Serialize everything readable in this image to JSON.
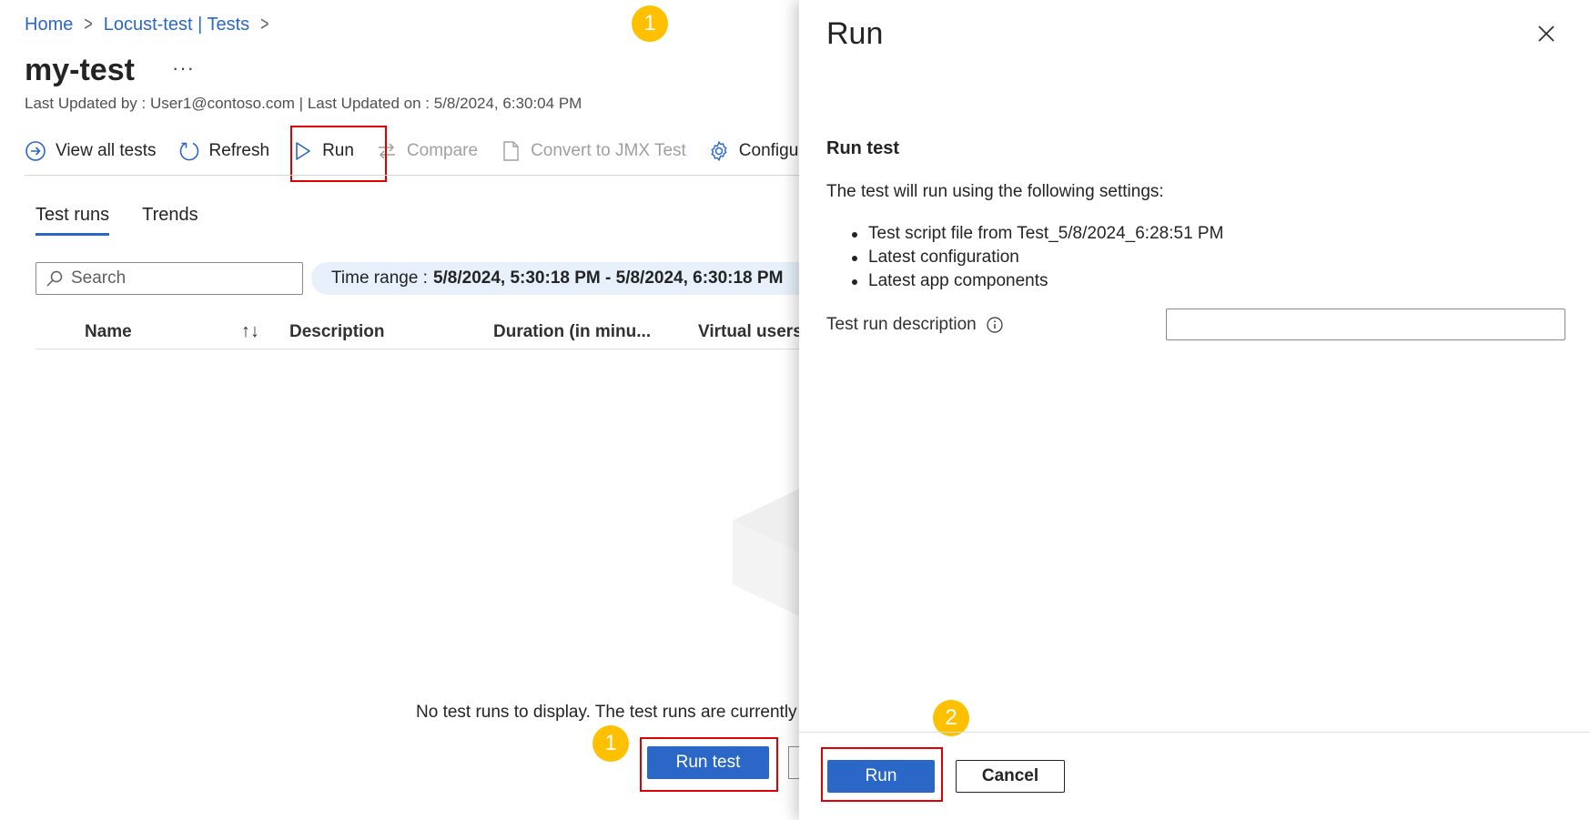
{
  "breadcrumb": {
    "home": "Home",
    "parent": "Locust-test | Tests",
    "sep": ">"
  },
  "page": {
    "title": "my-test",
    "more": "···",
    "subtitle": "Last Updated by : User1@contoso.com | Last Updated on : 5/8/2024, 6:30:04 PM"
  },
  "toolbar": {
    "view_all": "View all tests",
    "refresh": "Refresh",
    "run": "Run",
    "compare": "Compare",
    "convert": "Convert to JMX Test",
    "configure": "Configure"
  },
  "tabs": {
    "test_runs": "Test runs",
    "trends": "Trends"
  },
  "search": {
    "placeholder": "Search"
  },
  "time_range": {
    "label": "Time range :",
    "value": "5/8/2024, 5:30:18 PM - 5/8/2024, 6:30:18 PM"
  },
  "table": {
    "columns": {
      "name": "Name",
      "sort": "↑↓",
      "description": "Description",
      "duration": "Duration (in minu...",
      "virtual_users": "Virtual users"
    }
  },
  "empty": {
    "message": "No test runs to display. The test runs are currently",
    "run_test_label": "Run test"
  },
  "badges": {
    "one": "1",
    "two": "2"
  },
  "panel": {
    "title": "Run",
    "heading": "Run test",
    "description": "The test will run using the following settings:",
    "settings": [
      "Test script file from Test_5/8/2024_6:28:51 PM",
      "Latest configuration",
      "Latest app components"
    ],
    "field_label": "Test run description",
    "field_value": "",
    "run_label": "Run",
    "cancel_label": "Cancel"
  },
  "colors": {
    "accent": "#2b67c6",
    "highlight": "#e00000",
    "badge": "#ffc000"
  }
}
